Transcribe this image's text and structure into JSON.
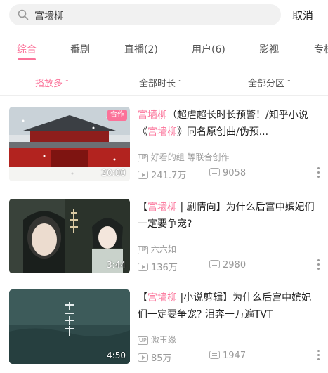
{
  "search": {
    "query": "宫墙柳",
    "cancel_label": "取消"
  },
  "colors": {
    "accent": "#fb7299",
    "muted": "#999999"
  },
  "tabs": [
    {
      "label": "综合",
      "active": true
    },
    {
      "label": "番剧"
    },
    {
      "label": "直播(2)"
    },
    {
      "label": "用户(6)"
    },
    {
      "label": "影视"
    },
    {
      "label": "专栏"
    }
  ],
  "filters": [
    {
      "label": "播放多",
      "active": true
    },
    {
      "label": "全部时长"
    },
    {
      "label": "全部分区"
    }
  ],
  "videos": [
    {
      "badge": "合作",
      "duration": "20:00",
      "title_parts": [
        {
          "text": "宫墙柳",
          "hl": true
        },
        {
          "text": "（超虐超长时长预警！/知乎小说《",
          "hl": false
        },
        {
          "text": "宫墙柳",
          "hl": true
        },
        {
          "text": "》同名原创曲/伪预...",
          "hl": false
        }
      ],
      "uploader": "好看的组 等联合创作",
      "views": "241.7万",
      "danmaku": "9058"
    },
    {
      "badge": "",
      "duration": "3:44",
      "title_parts": [
        {
          "text": "【",
          "hl": false
        },
        {
          "text": "宫墙柳",
          "hl": true
        },
        {
          "text": " | 剧情向】为什么后宫中嫔妃们一定要争宠?",
          "hl": false
        }
      ],
      "uploader": "六六如",
      "views": "136万",
      "danmaku": "2980"
    },
    {
      "badge": "",
      "duration": "4:50",
      "title_parts": [
        {
          "text": "【",
          "hl": false
        },
        {
          "text": "宫墙柳",
          "hl": true
        },
        {
          "text": " |小说剪辑】为什么后宫中嫔妃们一定要争宠? 泪奔一万遍TVT",
          "hl": false
        }
      ],
      "uploader": "溦玉缘",
      "views": "85万",
      "danmaku": "1947"
    }
  ]
}
